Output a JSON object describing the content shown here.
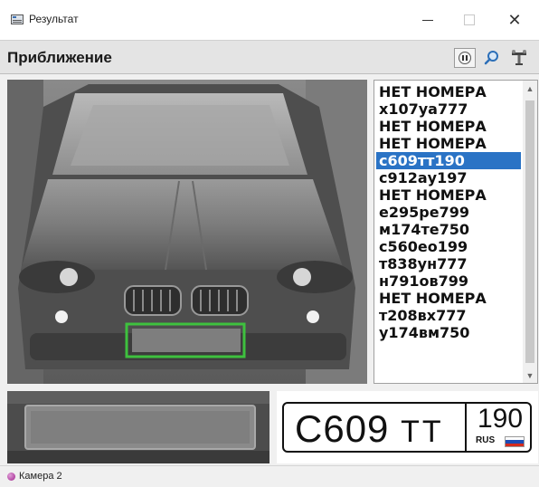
{
  "window": {
    "title": "Результат",
    "colors": {
      "titlebar": "#ffffff",
      "selection": "#2a73c5",
      "detection_box": "#3ec13e"
    }
  },
  "header": {
    "title": "Приближение",
    "tools": [
      "pause-icon",
      "zoom-icon",
      "settings-icon"
    ]
  },
  "plates": {
    "items": [
      "НЕТ НОМЕРА",
      "х107уа777",
      "НЕТ НОМЕРА",
      "НЕТ НОМЕРА",
      "с609тт190",
      "с912ау197",
      "НЕТ НОМЕРА",
      "е295ре799",
      "м174те750",
      "с560ео199",
      "т838ун777",
      "н791ов799",
      "НЕТ НОМЕРА",
      "т208вх777",
      "у174вм750"
    ],
    "selected_index": 4
  },
  "plate": {
    "letter": "С",
    "digits": "609",
    "series": "ТТ",
    "region": "190",
    "country": "RUS"
  },
  "status": {
    "camera": "Камера 2"
  }
}
